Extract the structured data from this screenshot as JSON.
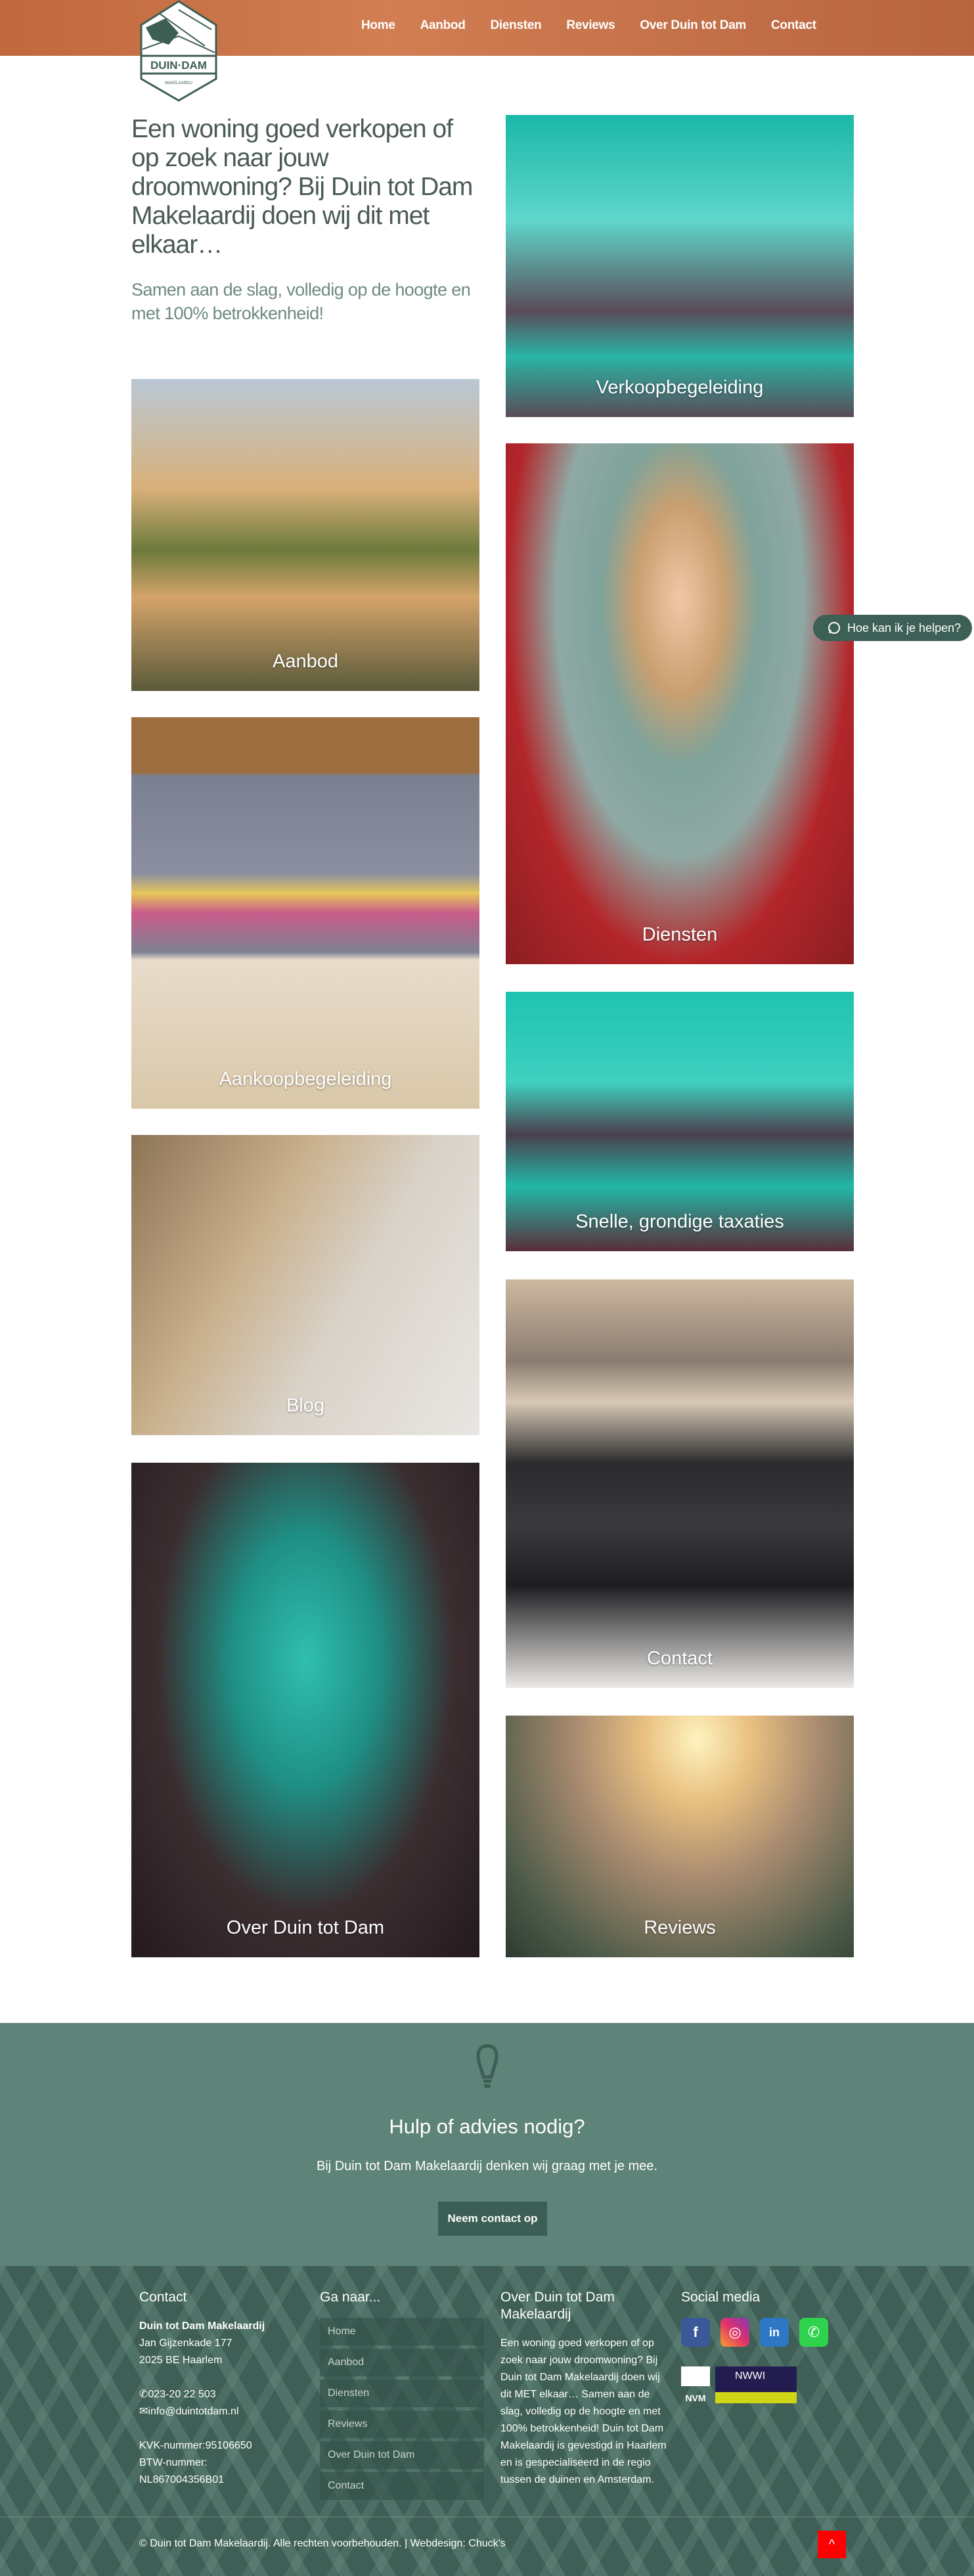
{
  "brand": {
    "logo_text": "DUIN tot DAM",
    "logo_sub": "MAKELAARDIJ",
    "primary": "#3d5e55",
    "accent": "#c4714a"
  },
  "nav": [
    "Home",
    "Aanbod",
    "Diensten",
    "Reviews",
    "Over Duin tot Dam",
    "Contact"
  ],
  "intro": {
    "heading": "Een woning goed verkopen of op zoek naar jouw droomwoning? Bij Duin tot Dam Makelaardij doen wij dit met elkaar…",
    "subtitle": "Samen aan de slag, volledig op de hoogte en met 100% betrokkenheid!"
  },
  "tiles": [
    "Aanbod",
    "Aankoopbegeleiding",
    "Blog",
    "Over Duin tot Dam",
    "Verkoopbegeleiding",
    "Diensten",
    "Snelle, grondige taxaties",
    "Contact",
    "Reviews"
  ],
  "whatsapp": {
    "label": "Hoe kan ik je helpen?",
    "icon": "whatsapp-icon"
  },
  "cta": {
    "icon": "lightbulb-icon",
    "heading": "Hulp of advies nodig?",
    "text": "Bij Duin tot Dam Makelaardij denken wij graag met je mee.",
    "button": "Neem contact op"
  },
  "footer": {
    "contact": {
      "heading": "Contact",
      "name": "Duin tot Dam Makelaardij",
      "street": "Jan Gijzenkade 177",
      "city": "2025 BE Haarlem",
      "phone": "023-20 22 503",
      "email": "info@duintotdam.nl",
      "kvk": "KVK-nummer:95106650",
      "btw_label": "BTW-nummer:",
      "btw": "NL867004356B01"
    },
    "goto": {
      "heading": "Ga naar...",
      "items": [
        "Home",
        "Aanbod",
        "Diensten",
        "Reviews",
        "Over Duin tot Dam",
        "Contact"
      ]
    },
    "about": {
      "heading": "Over Duin tot Dam Makelaardij",
      "text": "Een woning goed verkopen of op zoek naar jouw droomwoning? Bij Duin tot Dam Makelaardij doen wij dit MET elkaar… Samen aan de slag, volledig op de hoogte en met 100% betrokkenheid! Duin tot Dam Makelaardij is gevestigd in Haarlem en is gespecialiseerd in de regio tussen de duinen en Amsterdam."
    },
    "social": {
      "heading": "Social media",
      "items": [
        "f",
        "ig",
        "in",
        "wa"
      ],
      "badges": [
        "NVM",
        "NWWI"
      ]
    },
    "copyright": "© Duin tot Dam Makelaardij. Alle rechten voorbehouden. | Webdesign: Chuck's"
  }
}
